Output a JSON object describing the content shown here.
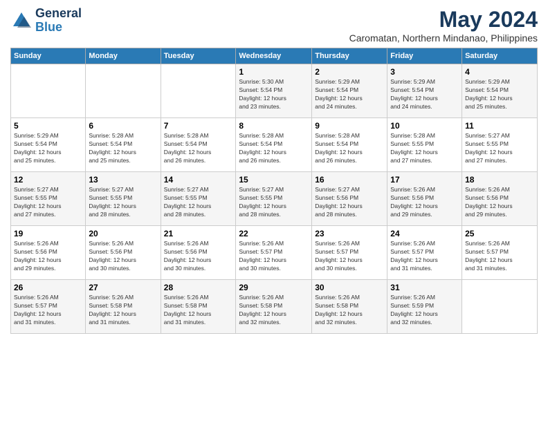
{
  "header": {
    "logo_line1": "General",
    "logo_line2": "Blue",
    "month_title": "May 2024",
    "location": "Caromatan, Northern Mindanao, Philippines"
  },
  "weekdays": [
    "Sunday",
    "Monday",
    "Tuesday",
    "Wednesday",
    "Thursday",
    "Friday",
    "Saturday"
  ],
  "weeks": [
    [
      {
        "day": "",
        "info": ""
      },
      {
        "day": "",
        "info": ""
      },
      {
        "day": "",
        "info": ""
      },
      {
        "day": "1",
        "info": "Sunrise: 5:30 AM\nSunset: 5:54 PM\nDaylight: 12 hours\nand 23 minutes."
      },
      {
        "day": "2",
        "info": "Sunrise: 5:29 AM\nSunset: 5:54 PM\nDaylight: 12 hours\nand 24 minutes."
      },
      {
        "day": "3",
        "info": "Sunrise: 5:29 AM\nSunset: 5:54 PM\nDaylight: 12 hours\nand 24 minutes."
      },
      {
        "day": "4",
        "info": "Sunrise: 5:29 AM\nSunset: 5:54 PM\nDaylight: 12 hours\nand 25 minutes."
      }
    ],
    [
      {
        "day": "5",
        "info": "Sunrise: 5:29 AM\nSunset: 5:54 PM\nDaylight: 12 hours\nand 25 minutes."
      },
      {
        "day": "6",
        "info": "Sunrise: 5:28 AM\nSunset: 5:54 PM\nDaylight: 12 hours\nand 25 minutes."
      },
      {
        "day": "7",
        "info": "Sunrise: 5:28 AM\nSunset: 5:54 PM\nDaylight: 12 hours\nand 26 minutes."
      },
      {
        "day": "8",
        "info": "Sunrise: 5:28 AM\nSunset: 5:54 PM\nDaylight: 12 hours\nand 26 minutes."
      },
      {
        "day": "9",
        "info": "Sunrise: 5:28 AM\nSunset: 5:54 PM\nDaylight: 12 hours\nand 26 minutes."
      },
      {
        "day": "10",
        "info": "Sunrise: 5:28 AM\nSunset: 5:55 PM\nDaylight: 12 hours\nand 27 minutes."
      },
      {
        "day": "11",
        "info": "Sunrise: 5:27 AM\nSunset: 5:55 PM\nDaylight: 12 hours\nand 27 minutes."
      }
    ],
    [
      {
        "day": "12",
        "info": "Sunrise: 5:27 AM\nSunset: 5:55 PM\nDaylight: 12 hours\nand 27 minutes."
      },
      {
        "day": "13",
        "info": "Sunrise: 5:27 AM\nSunset: 5:55 PM\nDaylight: 12 hours\nand 28 minutes."
      },
      {
        "day": "14",
        "info": "Sunrise: 5:27 AM\nSunset: 5:55 PM\nDaylight: 12 hours\nand 28 minutes."
      },
      {
        "day": "15",
        "info": "Sunrise: 5:27 AM\nSunset: 5:55 PM\nDaylight: 12 hours\nand 28 minutes."
      },
      {
        "day": "16",
        "info": "Sunrise: 5:27 AM\nSunset: 5:56 PM\nDaylight: 12 hours\nand 28 minutes."
      },
      {
        "day": "17",
        "info": "Sunrise: 5:26 AM\nSunset: 5:56 PM\nDaylight: 12 hours\nand 29 minutes."
      },
      {
        "day": "18",
        "info": "Sunrise: 5:26 AM\nSunset: 5:56 PM\nDaylight: 12 hours\nand 29 minutes."
      }
    ],
    [
      {
        "day": "19",
        "info": "Sunrise: 5:26 AM\nSunset: 5:56 PM\nDaylight: 12 hours\nand 29 minutes."
      },
      {
        "day": "20",
        "info": "Sunrise: 5:26 AM\nSunset: 5:56 PM\nDaylight: 12 hours\nand 30 minutes."
      },
      {
        "day": "21",
        "info": "Sunrise: 5:26 AM\nSunset: 5:56 PM\nDaylight: 12 hours\nand 30 minutes."
      },
      {
        "day": "22",
        "info": "Sunrise: 5:26 AM\nSunset: 5:57 PM\nDaylight: 12 hours\nand 30 minutes."
      },
      {
        "day": "23",
        "info": "Sunrise: 5:26 AM\nSunset: 5:57 PM\nDaylight: 12 hours\nand 30 minutes."
      },
      {
        "day": "24",
        "info": "Sunrise: 5:26 AM\nSunset: 5:57 PM\nDaylight: 12 hours\nand 31 minutes."
      },
      {
        "day": "25",
        "info": "Sunrise: 5:26 AM\nSunset: 5:57 PM\nDaylight: 12 hours\nand 31 minutes."
      }
    ],
    [
      {
        "day": "26",
        "info": "Sunrise: 5:26 AM\nSunset: 5:57 PM\nDaylight: 12 hours\nand 31 minutes."
      },
      {
        "day": "27",
        "info": "Sunrise: 5:26 AM\nSunset: 5:58 PM\nDaylight: 12 hours\nand 31 minutes."
      },
      {
        "day": "28",
        "info": "Sunrise: 5:26 AM\nSunset: 5:58 PM\nDaylight: 12 hours\nand 31 minutes."
      },
      {
        "day": "29",
        "info": "Sunrise: 5:26 AM\nSunset: 5:58 PM\nDaylight: 12 hours\nand 32 minutes."
      },
      {
        "day": "30",
        "info": "Sunrise: 5:26 AM\nSunset: 5:58 PM\nDaylight: 12 hours\nand 32 minutes."
      },
      {
        "day": "31",
        "info": "Sunrise: 5:26 AM\nSunset: 5:59 PM\nDaylight: 12 hours\nand 32 minutes."
      },
      {
        "day": "",
        "info": ""
      }
    ]
  ]
}
